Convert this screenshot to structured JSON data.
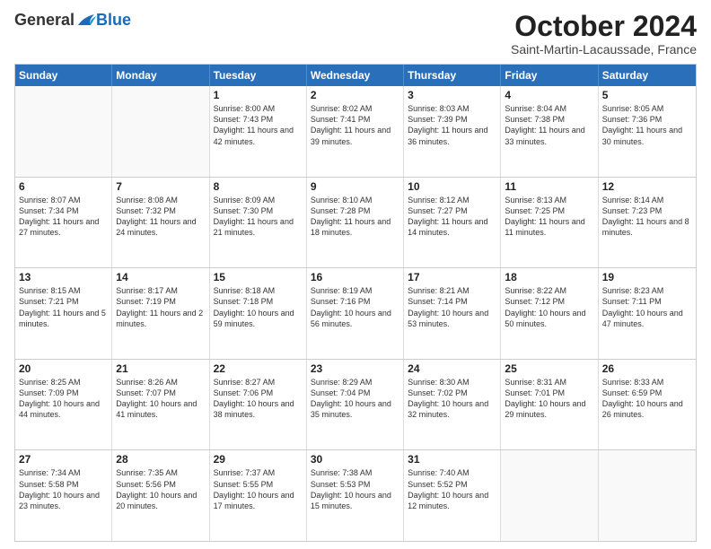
{
  "header": {
    "logo": {
      "general": "General",
      "blue": "Blue"
    },
    "title": "October 2024",
    "subtitle": "Saint-Martin-Lacaussade, France"
  },
  "calendar": {
    "days": [
      "Sunday",
      "Monday",
      "Tuesday",
      "Wednesday",
      "Thursday",
      "Friday",
      "Saturday"
    ],
    "rows": [
      [
        {
          "day": "",
          "content": ""
        },
        {
          "day": "",
          "content": ""
        },
        {
          "day": "1",
          "content": "Sunrise: 8:00 AM\nSunset: 7:43 PM\nDaylight: 11 hours and 42 minutes."
        },
        {
          "day": "2",
          "content": "Sunrise: 8:02 AM\nSunset: 7:41 PM\nDaylight: 11 hours and 39 minutes."
        },
        {
          "day": "3",
          "content": "Sunrise: 8:03 AM\nSunset: 7:39 PM\nDaylight: 11 hours and 36 minutes."
        },
        {
          "day": "4",
          "content": "Sunrise: 8:04 AM\nSunset: 7:38 PM\nDaylight: 11 hours and 33 minutes."
        },
        {
          "day": "5",
          "content": "Sunrise: 8:05 AM\nSunset: 7:36 PM\nDaylight: 11 hours and 30 minutes."
        }
      ],
      [
        {
          "day": "6",
          "content": "Sunrise: 8:07 AM\nSunset: 7:34 PM\nDaylight: 11 hours and 27 minutes."
        },
        {
          "day": "7",
          "content": "Sunrise: 8:08 AM\nSunset: 7:32 PM\nDaylight: 11 hours and 24 minutes."
        },
        {
          "day": "8",
          "content": "Sunrise: 8:09 AM\nSunset: 7:30 PM\nDaylight: 11 hours and 21 minutes."
        },
        {
          "day": "9",
          "content": "Sunrise: 8:10 AM\nSunset: 7:28 PM\nDaylight: 11 hours and 18 minutes."
        },
        {
          "day": "10",
          "content": "Sunrise: 8:12 AM\nSunset: 7:27 PM\nDaylight: 11 hours and 14 minutes."
        },
        {
          "day": "11",
          "content": "Sunrise: 8:13 AM\nSunset: 7:25 PM\nDaylight: 11 hours and 11 minutes."
        },
        {
          "day": "12",
          "content": "Sunrise: 8:14 AM\nSunset: 7:23 PM\nDaylight: 11 hours and 8 minutes."
        }
      ],
      [
        {
          "day": "13",
          "content": "Sunrise: 8:15 AM\nSunset: 7:21 PM\nDaylight: 11 hours and 5 minutes."
        },
        {
          "day": "14",
          "content": "Sunrise: 8:17 AM\nSunset: 7:19 PM\nDaylight: 11 hours and 2 minutes."
        },
        {
          "day": "15",
          "content": "Sunrise: 8:18 AM\nSunset: 7:18 PM\nDaylight: 10 hours and 59 minutes."
        },
        {
          "day": "16",
          "content": "Sunrise: 8:19 AM\nSunset: 7:16 PM\nDaylight: 10 hours and 56 minutes."
        },
        {
          "day": "17",
          "content": "Sunrise: 8:21 AM\nSunset: 7:14 PM\nDaylight: 10 hours and 53 minutes."
        },
        {
          "day": "18",
          "content": "Sunrise: 8:22 AM\nSunset: 7:12 PM\nDaylight: 10 hours and 50 minutes."
        },
        {
          "day": "19",
          "content": "Sunrise: 8:23 AM\nSunset: 7:11 PM\nDaylight: 10 hours and 47 minutes."
        }
      ],
      [
        {
          "day": "20",
          "content": "Sunrise: 8:25 AM\nSunset: 7:09 PM\nDaylight: 10 hours and 44 minutes."
        },
        {
          "day": "21",
          "content": "Sunrise: 8:26 AM\nSunset: 7:07 PM\nDaylight: 10 hours and 41 minutes."
        },
        {
          "day": "22",
          "content": "Sunrise: 8:27 AM\nSunset: 7:06 PM\nDaylight: 10 hours and 38 minutes."
        },
        {
          "day": "23",
          "content": "Sunrise: 8:29 AM\nSunset: 7:04 PM\nDaylight: 10 hours and 35 minutes."
        },
        {
          "day": "24",
          "content": "Sunrise: 8:30 AM\nSunset: 7:02 PM\nDaylight: 10 hours and 32 minutes."
        },
        {
          "day": "25",
          "content": "Sunrise: 8:31 AM\nSunset: 7:01 PM\nDaylight: 10 hours and 29 minutes."
        },
        {
          "day": "26",
          "content": "Sunrise: 8:33 AM\nSunset: 6:59 PM\nDaylight: 10 hours and 26 minutes."
        }
      ],
      [
        {
          "day": "27",
          "content": "Sunrise: 7:34 AM\nSunset: 5:58 PM\nDaylight: 10 hours and 23 minutes."
        },
        {
          "day": "28",
          "content": "Sunrise: 7:35 AM\nSunset: 5:56 PM\nDaylight: 10 hours and 20 minutes."
        },
        {
          "day": "29",
          "content": "Sunrise: 7:37 AM\nSunset: 5:55 PM\nDaylight: 10 hours and 17 minutes."
        },
        {
          "day": "30",
          "content": "Sunrise: 7:38 AM\nSunset: 5:53 PM\nDaylight: 10 hours and 15 minutes."
        },
        {
          "day": "31",
          "content": "Sunrise: 7:40 AM\nSunset: 5:52 PM\nDaylight: 10 hours and 12 minutes."
        },
        {
          "day": "",
          "content": ""
        },
        {
          "day": "",
          "content": ""
        }
      ]
    ]
  }
}
